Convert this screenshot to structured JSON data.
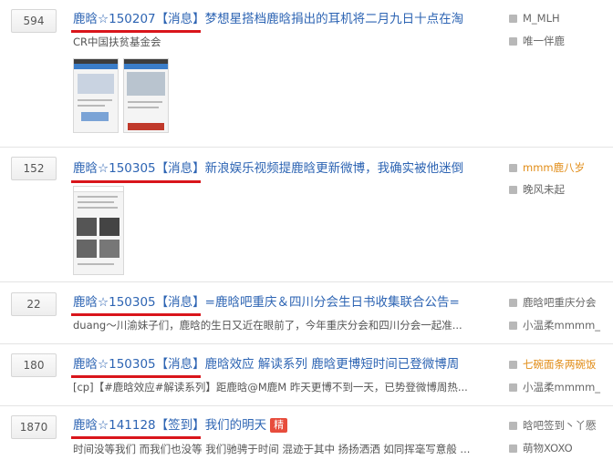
{
  "threads": [
    {
      "replies": "594",
      "prefix": "鹿晗☆150207【消息】",
      "title": "梦想星搭档鹿晗捐出的耳机将二月九日十点在淘",
      "desc": "CR中国扶贫基金会",
      "author": "M_MLH",
      "last_reply": "唯一伴鹿",
      "author_color": "#666666",
      "has_thumbs": 2
    },
    {
      "replies": "152",
      "prefix": "鹿晗☆150305【消息】",
      "title": "新浪娱乐视频提鹿晗更新微博，我确实被他迷倒",
      "desc": "",
      "author": "mmm鹿八岁",
      "last_reply": "晚风未起",
      "author_color": "#e18c16",
      "has_thumbs": 1
    },
    {
      "replies": "22",
      "prefix": "鹿晗☆150305【消息】",
      "title": "=鹿晗吧重庆＆四川分会生日书收集联合公告=",
      "desc": "duang～川渝妹子们，鹿晗的生日又近在眼前了，今年重庆分会和四川分会一起准...",
      "author": "鹿晗吧重庆分会",
      "last_reply": "小温柔mmmm_",
      "author_color": "#666666"
    },
    {
      "replies": "180",
      "prefix": "鹿晗☆150305【消息】",
      "title": "鹿晗效应 解读系列 鹿晗更博短时间已登微博周",
      "desc": "[cp]【#鹿晗效应#解读系列】距鹿晗@M鹿M 昨天更博不到一天，已势登微博周热...",
      "author": "七碗面条两碗饭",
      "last_reply": "小温柔mmmm_",
      "author_color": "#e18c16"
    },
    {
      "replies": "1870",
      "prefix": "鹿晗☆141128【签到】",
      "title": "我们的明天",
      "badge": "精",
      "desc": "时间没等我们 而我们也没等 我们驰骋于时间 混迹于其中 扬扬洒洒 如同挥毫写意般 ...",
      "author": "晗吧签到丶丫憠",
      "last_reply": "萌物XOXO",
      "author_color": "#666666"
    }
  ]
}
